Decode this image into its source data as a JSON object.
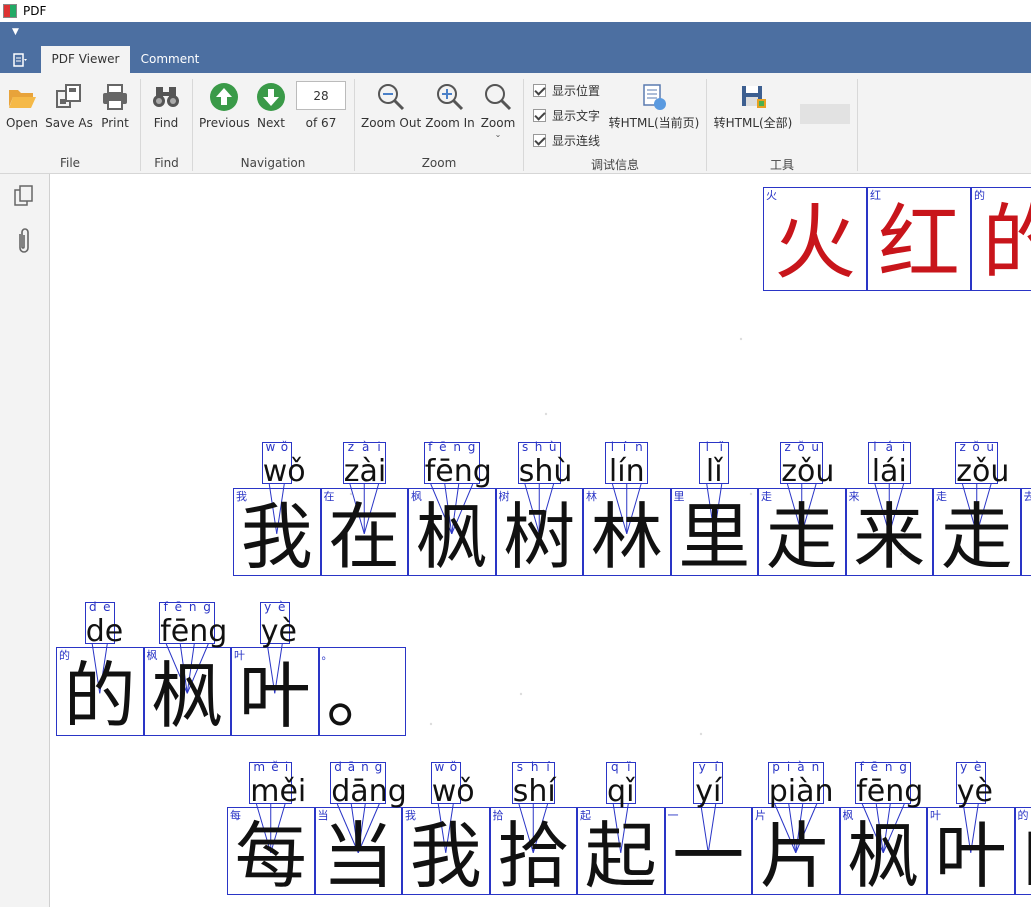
{
  "window": {
    "title": "PDF"
  },
  "tabs": [
    "PDF Viewer",
    "Comment"
  ],
  "ribbon": {
    "file": {
      "open": "Open",
      "save_as": "Save As",
      "print": "Print",
      "group": "File"
    },
    "find": {
      "find": "Find",
      "group": "Find"
    },
    "navigation": {
      "previous": "Previous",
      "next": "Next",
      "page": "28",
      "of": "of 67",
      "group": "Navigation"
    },
    "zoom": {
      "zoom_out": "Zoom Out",
      "zoom_in": "Zoom In",
      "zoom": "Zoom",
      "group": "Zoom"
    },
    "debug": {
      "show_pos": "显示位置",
      "show_text": "显示文字",
      "show_lines": "显示连线",
      "to_html_current": "转HTML(当前页)",
      "group": "调试信息"
    },
    "tools": {
      "to_html_all": "转HTML(全部)",
      "group": "工具"
    }
  },
  "colors": {
    "accent": "#4c6fa1",
    "box": "#2a35c6",
    "title_red": "#c8151b"
  },
  "title_chars": [
    {
      "small": "火",
      "big": "火"
    },
    {
      "small": "红",
      "big": "红"
    },
    {
      "small": "的",
      "big": "的"
    }
  ],
  "line1": {
    "pinyin": [
      {
        "letters": [
          "w",
          "ǒ"
        ],
        "text": "wǒ"
      },
      {
        "letters": [
          "z",
          "à",
          "i"
        ],
        "text": "zài"
      },
      {
        "letters": [
          "f",
          "ē",
          "n",
          "g"
        ],
        "text": "fēng"
      },
      {
        "letters": [
          "s",
          "h",
          "ù"
        ],
        "text": "shù"
      },
      {
        "letters": [
          "l",
          "í",
          "n"
        ],
        "text": "lín"
      },
      {
        "letters": [
          "l",
          "ǐ"
        ],
        "text": "lǐ"
      },
      {
        "letters": [
          "z",
          "ǒ",
          "u"
        ],
        "text": "zǒu"
      },
      {
        "letters": [
          "l",
          "á",
          "i"
        ],
        "text": "lái"
      },
      {
        "letters": [
          "z",
          "ǒ",
          "u"
        ],
        "text": "zǒu"
      }
    ],
    "chars": [
      {
        "small": "我",
        "big": "我"
      },
      {
        "small": "在",
        "big": "在"
      },
      {
        "small": "枫",
        "big": "枫"
      },
      {
        "small": "树",
        "big": "树"
      },
      {
        "small": "林",
        "big": "林"
      },
      {
        "small": "里",
        "big": "里"
      },
      {
        "small": "走",
        "big": "走"
      },
      {
        "small": "来",
        "big": "来"
      },
      {
        "small": "走",
        "big": "走"
      },
      {
        "small": "去",
        "big": "去"
      }
    ]
  },
  "line2": {
    "pinyin": [
      {
        "letters": [
          "d",
          "e"
        ],
        "text": "de"
      },
      {
        "letters": [
          "f",
          "ē",
          "n",
          "g"
        ],
        "text": "fēng"
      },
      {
        "letters": [
          "y",
          "è"
        ],
        "text": "yè"
      }
    ],
    "chars": [
      {
        "small": "的",
        "big": "的"
      },
      {
        "small": "枫",
        "big": "枫"
      },
      {
        "small": "叶",
        "big": "叶"
      },
      {
        "small": "。",
        "big": "。"
      }
    ]
  },
  "line3": {
    "pinyin": [
      {
        "letters": [
          "m",
          "ě",
          "i"
        ],
        "text": "měi"
      },
      {
        "letters": [
          "d",
          "ā",
          "n",
          "g"
        ],
        "text": "dāng"
      },
      {
        "letters": [
          "w",
          "ǒ"
        ],
        "text": "wǒ"
      },
      {
        "letters": [
          "s",
          "h",
          "í"
        ],
        "text": "shí"
      },
      {
        "letters": [
          "q",
          "ǐ"
        ],
        "text": "qǐ"
      },
      {
        "letters": [
          "y",
          "í"
        ],
        "text": "yí"
      },
      {
        "letters": [
          "p",
          "i",
          "à",
          "n"
        ],
        "text": "piàn"
      },
      {
        "letters": [
          "f",
          "ē",
          "n",
          "g"
        ],
        "text": "fēng"
      },
      {
        "letters": [
          "y",
          "è"
        ],
        "text": "yè"
      }
    ],
    "chars": [
      {
        "small": "每",
        "big": "每"
      },
      {
        "small": "当",
        "big": "当"
      },
      {
        "small": "我",
        "big": "我"
      },
      {
        "small": "拾",
        "big": "拾"
      },
      {
        "small": "起",
        "big": "起"
      },
      {
        "small": "一",
        "big": "一"
      },
      {
        "small": "片",
        "big": "片"
      },
      {
        "small": "枫",
        "big": "枫"
      },
      {
        "small": "叶",
        "big": "叶"
      },
      {
        "small": "的",
        "big": "的"
      }
    ]
  }
}
